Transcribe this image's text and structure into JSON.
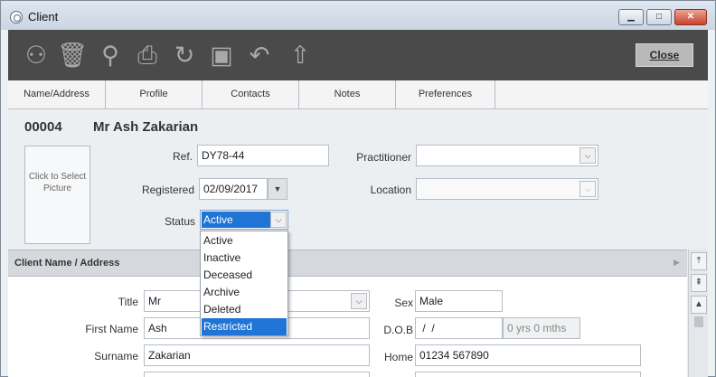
{
  "window": {
    "title": "Client",
    "min_icon": "minimize-icon",
    "max_icon": "maximize-icon",
    "close_icon": "close-icon"
  },
  "toolbar": {
    "tools": [
      {
        "name": "add-client-icon",
        "glyph": "⚇"
      },
      {
        "name": "delete-icon",
        "glyph": "🗑"
      },
      {
        "name": "search-icon",
        "glyph": "⚲"
      },
      {
        "name": "print-icon",
        "glyph": "⎙"
      },
      {
        "name": "history-icon",
        "glyph": "↻"
      },
      {
        "name": "save-icon",
        "glyph": "▣"
      },
      {
        "name": "undo-icon",
        "glyph": "↶"
      },
      {
        "name": "up-arrow-icon",
        "glyph": "⇧"
      }
    ],
    "close_label": "Close"
  },
  "tabs": [
    "Name/Address",
    "Profile",
    "Contacts",
    "Notes",
    "Preferences"
  ],
  "client": {
    "id": "00004",
    "name": "Mr Ash Zakarian"
  },
  "picture_label": "Click to Select Picture",
  "header_fields": {
    "ref_label": "Ref.",
    "ref_value": "DY78-44",
    "registered_label": "Registered",
    "registered_value": "02/09/2017",
    "status_label": "Status",
    "status_value": "Active",
    "practitioner_label": "Practitioner",
    "practitioner_value": "",
    "location_label": "Location",
    "location_value": ""
  },
  "status_options": [
    "Active",
    "Inactive",
    "Deceased",
    "Archive",
    "Deleted",
    "Restricted"
  ],
  "status_highlighted": "Restricted",
  "section": {
    "title": "Client Name / Address"
  },
  "address": {
    "title_label": "Title",
    "title_value": "Mr",
    "first_name_label": "First Name",
    "first_name_value": "Ash",
    "surname_label": "Surname",
    "surname_value": "Zakarian",
    "sex_label": "Sex",
    "sex_value": "Male",
    "dob_label": "D.O.B",
    "dob_value": " /  /",
    "age_value": "0 yrs 0 mths",
    "home_label": "Home",
    "home_value": "01234 567890"
  }
}
